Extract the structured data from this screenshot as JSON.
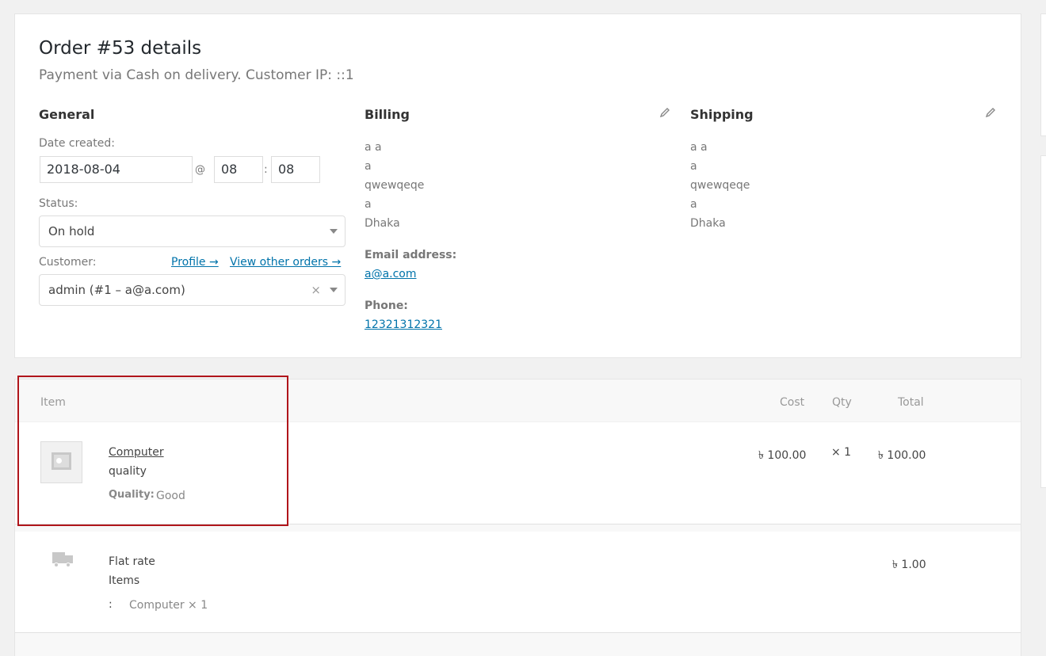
{
  "order": {
    "title": "Order #53 details",
    "subtitle": "Payment via Cash on delivery. Customer IP: ::1"
  },
  "general": {
    "heading": "General",
    "date_label": "Date created:",
    "date_value": "2018-08-04",
    "at": "@",
    "hour": "08",
    "colon": ":",
    "minute": "08",
    "status_label": "Status:",
    "status_value": "On hold",
    "customer_label": "Customer:",
    "profile_link": "Profile →",
    "orders_link": "View other orders →",
    "customer_value": "admin (#1 – a@a.com)",
    "clear_glyph": "×"
  },
  "billing": {
    "heading": "Billing",
    "address": [
      "a a",
      "a",
      "qwewqeqe",
      "a",
      "Dhaka"
    ],
    "email_label": "Email address:",
    "email": "a@a.com",
    "phone_label": "Phone:",
    "phone": "12321312321"
  },
  "shipping": {
    "heading": "Shipping",
    "address": [
      "a a",
      "a",
      "qwewqeqe",
      "a",
      "Dhaka"
    ]
  },
  "items_table": {
    "headers": {
      "item": "Item",
      "cost": "Cost",
      "qty": "Qty",
      "total": "Total"
    },
    "line_item": {
      "name": "Computer",
      "variation": "quality",
      "meta_label": "Quality:",
      "meta_value": "Good",
      "cost": "৳ 100.00",
      "qty": "× 1",
      "total": "৳ 100.00"
    },
    "shipping_line": {
      "method": "Flat rate",
      "items_label": "Items",
      "items_colon": ":",
      "items_value": "Computer × 1",
      "total": "৳ 1.00"
    }
  },
  "colors": {
    "link": "#0073aa",
    "highlight": "#b0151b"
  },
  "icons": {
    "edit": "pencil-icon",
    "thumbnail": "image-placeholder-icon",
    "shipping": "truck-icon"
  }
}
